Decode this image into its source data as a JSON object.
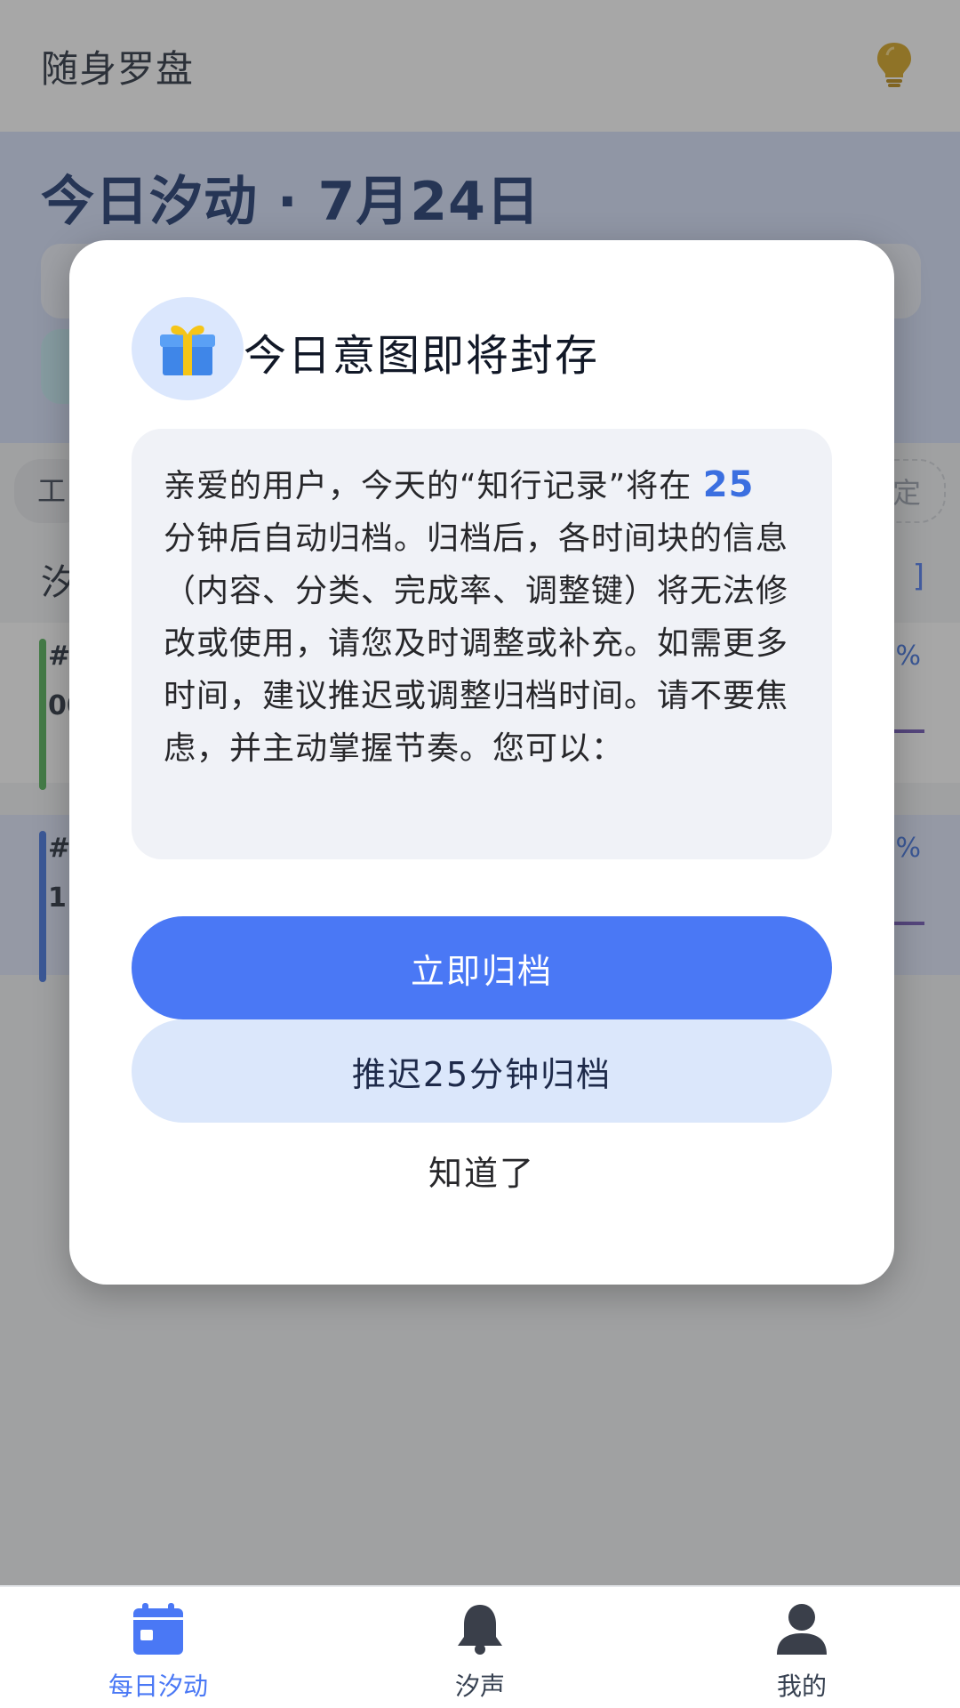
{
  "app": {
    "title": "随身罗盘",
    "icon": "lightbulb-icon"
  },
  "banner": {
    "date_title": "今日汐动 · 7月24日"
  },
  "filters": {
    "left_chip": "工",
    "right_chip": "定"
  },
  "section": {
    "title": "汐",
    "link": "]"
  },
  "tasks": [
    {
      "hash": "#",
      "time": "00",
      "percent": "0%"
    },
    {
      "hash": "#",
      "time": "1",
      "percent": "0%"
    }
  ],
  "modal": {
    "icon": "gift-icon",
    "title": "今日意图即将封存",
    "message_prefix": "亲爱的用户，今天的“知行记录”将在 ",
    "minutes": "25",
    "message_suffix": "分钟后自动归档。归档后，各时间块的信息（内容、分类、完成率、调整键）将无法修改或使用，请您及时调整或补充。如需更多时间，建议推迟或调整归档时间。请不要焦虑，并主动掌握节奏。您可以：",
    "primary_button": "立即归档",
    "secondary_button": "推迟25分钟归档",
    "dismiss_button": "知道了"
  },
  "nav": {
    "items": [
      {
        "label": "每日汐动",
        "icon": "calendar-icon",
        "active": true
      },
      {
        "label": "汐声",
        "icon": "bell-icon",
        "active": false
      },
      {
        "label": "我的",
        "icon": "user-icon",
        "active": false
      }
    ]
  },
  "colors": {
    "accent": "#4a78f5",
    "title_dark": "#14306b",
    "secondary_button_bg": "#dbe7fb"
  }
}
